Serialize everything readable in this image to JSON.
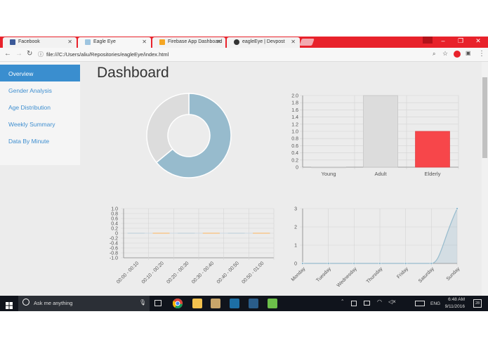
{
  "browser": {
    "tabs": [
      {
        "label": "Facebook",
        "color": "#3b5998"
      },
      {
        "label": "Eagle Eye",
        "color": "#9ec5e0"
      },
      {
        "label": "Firebase App Dashboard",
        "color": "#f5a623"
      },
      {
        "label": "eagleEye | Devpost",
        "color": "#333333"
      }
    ],
    "url": "file:///C:/Users/aliu/Repositories/eagleEye/index.html"
  },
  "sidebar": {
    "items": [
      {
        "label": "Overview"
      },
      {
        "label": "Gender Analysis"
      },
      {
        "label": "Age Distribution"
      },
      {
        "label": "Weekly Summary"
      },
      {
        "label": "Data By Minute"
      }
    ]
  },
  "page": {
    "title": "Dashboard"
  },
  "taskbar": {
    "search_placeholder": "Ask me anything",
    "lang": "ENG",
    "time": "6:48 AM",
    "date": "9/11/2016",
    "notifications": "28"
  },
  "chart_data": [
    {
      "type": "pie",
      "subtype": "doughnut",
      "values": [
        64,
        36
      ],
      "colors": [
        "#97bbcd",
        "#dcdcdc"
      ]
    },
    {
      "type": "bar",
      "categories": [
        "Young",
        "Adult",
        "Elderly"
      ],
      "values": [
        0,
        2,
        1
      ],
      "colors": [
        "#97bbcd",
        "#dcdcdc",
        "#f7464a"
      ],
      "ylim": [
        0,
        2
      ],
      "yticks": [
        "2.0",
        "1.8",
        "1.6",
        "1.4",
        "1.2",
        "1.0",
        "0.8",
        "0.6",
        "0.4",
        "0.2",
        "0"
      ]
    },
    {
      "type": "line",
      "categories": [
        "00:00 - 00:10",
        "00:10 - 00:20",
        "00:20 - 00:30",
        "00:30 - 00:40",
        "00:40 - 00:50",
        "00:50 - 01:00"
      ],
      "series": [
        {
          "values": [
            0,
            0,
            0,
            0,
            0,
            0
          ],
          "color": "#97bbcd"
        },
        {
          "values": [
            0,
            0,
            0,
            0,
            0,
            0
          ],
          "color": "#f7464a"
        },
        {
          "values": [
            0,
            0,
            0,
            0,
            0,
            0
          ],
          "color": "#46bfbd"
        },
        {
          "values": [
            0,
            0,
            0,
            0,
            0,
            0
          ],
          "color": "#fdb45c"
        }
      ],
      "ylim": [
        -1,
        1
      ],
      "yticks": [
        "1.0",
        "0.8",
        "0.6",
        "0.4",
        "0.2",
        "0",
        "-0.2",
        "-0.4",
        "-0.6",
        "-0.8",
        "-1.0"
      ]
    },
    {
      "type": "area",
      "categories": [
        "Monday",
        "Tuesday",
        "Wednesday",
        "Thursday",
        "Friday",
        "Saturday",
        "Sunday"
      ],
      "values": [
        0,
        0,
        0,
        0,
        0,
        0,
        3
      ],
      "color": "#97bbcd",
      "ylim": [
        0,
        3
      ],
      "yticks": [
        "3",
        "2",
        "1",
        "0"
      ]
    }
  ]
}
